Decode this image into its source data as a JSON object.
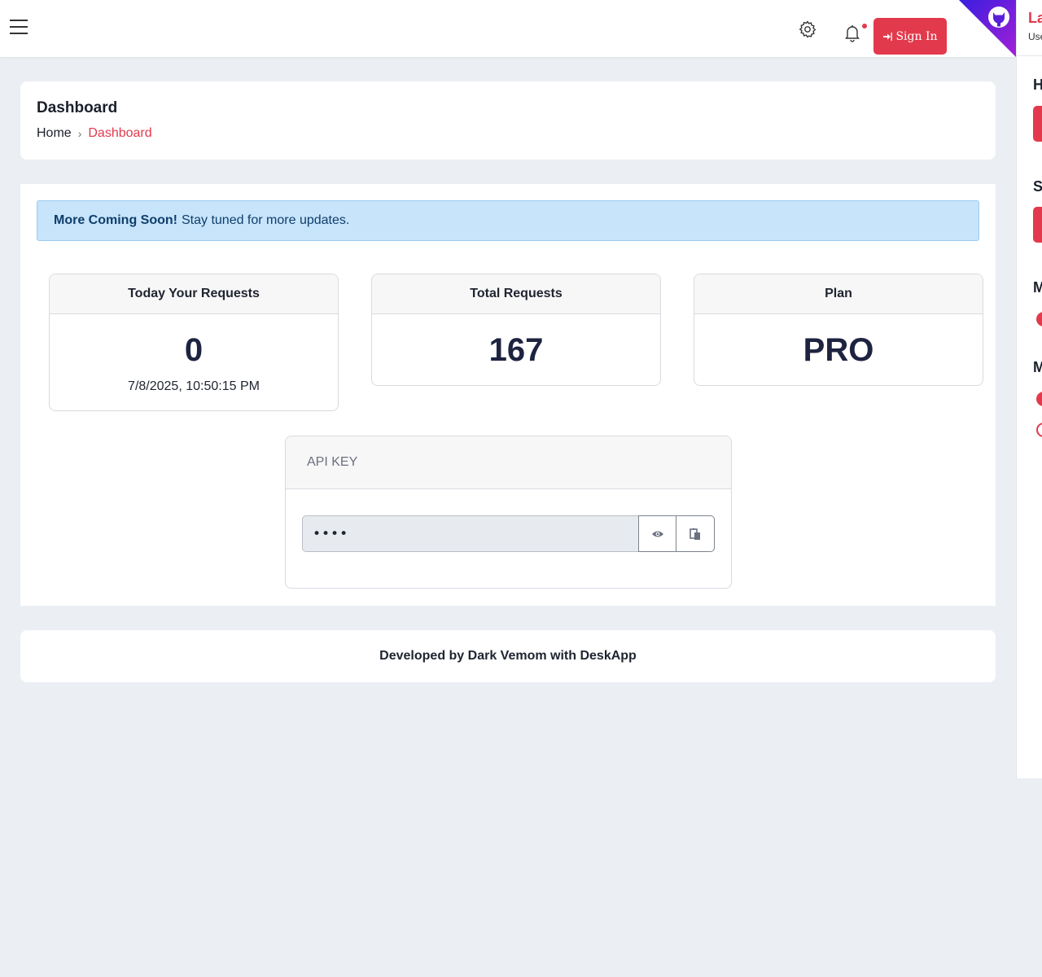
{
  "header": {
    "sign_in_label": "Sign In"
  },
  "right_panel": {
    "title": "La",
    "subtitle": "Use",
    "headings": [
      "H",
      "S",
      "M",
      "M"
    ]
  },
  "page": {
    "title": "Dashboard",
    "breadcrumb": {
      "home": "Home",
      "separator": "›",
      "current": "Dashboard"
    }
  },
  "alert": {
    "strong": "More Coming Soon!",
    "text": "Stay tuned for more updates."
  },
  "stats": [
    {
      "label": "Today Your Requests",
      "value": "0",
      "detail": "7/8/2025, 10:50:15 PM"
    },
    {
      "label": "Total Requests",
      "value": "167"
    },
    {
      "label": "Plan",
      "value": "PRO"
    }
  ],
  "api_key": {
    "label": "API KEY",
    "value": "••••"
  },
  "footer": {
    "text": "Developed by Dark Vemom with DeskApp"
  },
  "colors": {
    "accent": "#e23a4c",
    "alert_bg": "#c7e4fb",
    "corner_gradient": [
      "#3a1ee0",
      "#a31fd6"
    ]
  }
}
